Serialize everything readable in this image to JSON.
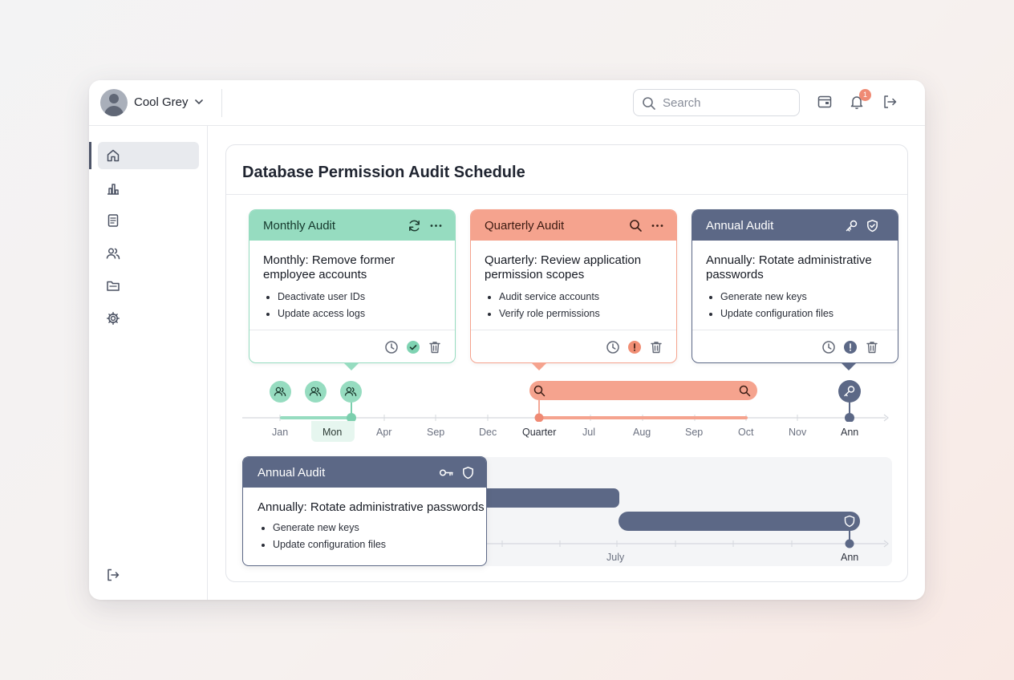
{
  "user": {
    "name": "Cool Grey"
  },
  "search": {
    "placeholder": "Search"
  },
  "notifications": {
    "count": "1"
  },
  "page": {
    "title": "Database Permission Audit Schedule"
  },
  "cards": [
    {
      "header": "Monthly Audit",
      "title": "Monthly: Remove former employee accounts",
      "items": [
        "Deactivate user IDs",
        "Update access logs"
      ],
      "color": "#96dcc0"
    },
    {
      "header": "Quarterly Audit",
      "title": "Quarterly: Review application permission scopes",
      "items": [
        "Audit service accounts",
        "Verify role permissions"
      ],
      "color": "#f5a38e"
    },
    {
      "header": "Annual Audit",
      "title": "Annually: Rotate administrative passwords",
      "items": [
        "Generate new keys",
        "Update configuration files"
      ],
      "color": "#5c6886"
    }
  ],
  "timeline": {
    "ticks": [
      "Jan",
      "Mon",
      "Apr",
      "Sep",
      "Dec",
      "Quarter",
      "Jul",
      "Aug",
      "Sep",
      "Oct",
      "Nov",
      "Ann"
    ]
  },
  "lower": {
    "card": {
      "header": "Annual Audit",
      "title": "Annually: Rotate administrative passwords",
      "items": [
        "Generate new keys",
        "Update configuration files"
      ]
    },
    "ticks": [
      "July",
      "Ann"
    ]
  }
}
